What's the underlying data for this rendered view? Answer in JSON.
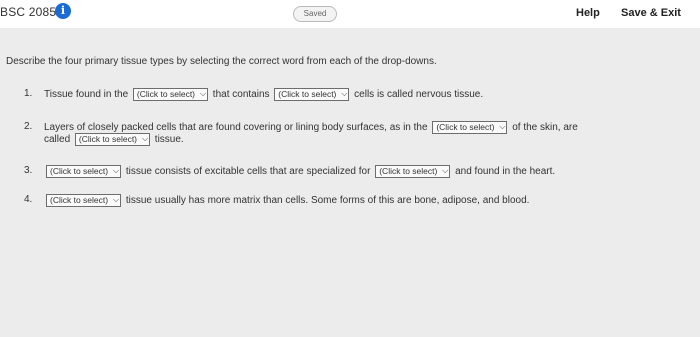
{
  "header": {
    "course": "BSC 2085",
    "info_glyph": "i",
    "saved_label": "Saved",
    "help_label": "Help",
    "save_exit_label": "Save & Exit"
  },
  "instruction": "Describe the four primary tissue types by selecting the correct word from each of the drop-downs.",
  "select_placeholder": "(Click to select)",
  "questions": [
    {
      "num": "1.",
      "parts": [
        "Tissue found in the",
        "that contains",
        "cells is called nervous tissue."
      ]
    },
    {
      "num": "2.",
      "parts": [
        "Layers of closely packed cells that are found covering or lining body surfaces, as in the",
        "of the skin, are",
        "called",
        "tissue."
      ]
    },
    {
      "num": "3.",
      "parts": [
        "tissue consists of excitable cells that are specialized for",
        "and found in the heart."
      ]
    },
    {
      "num": "4.",
      "parts": [
        "tissue usually has more matrix than cells. Some forms of this are bone, adipose, and blood."
      ]
    }
  ]
}
